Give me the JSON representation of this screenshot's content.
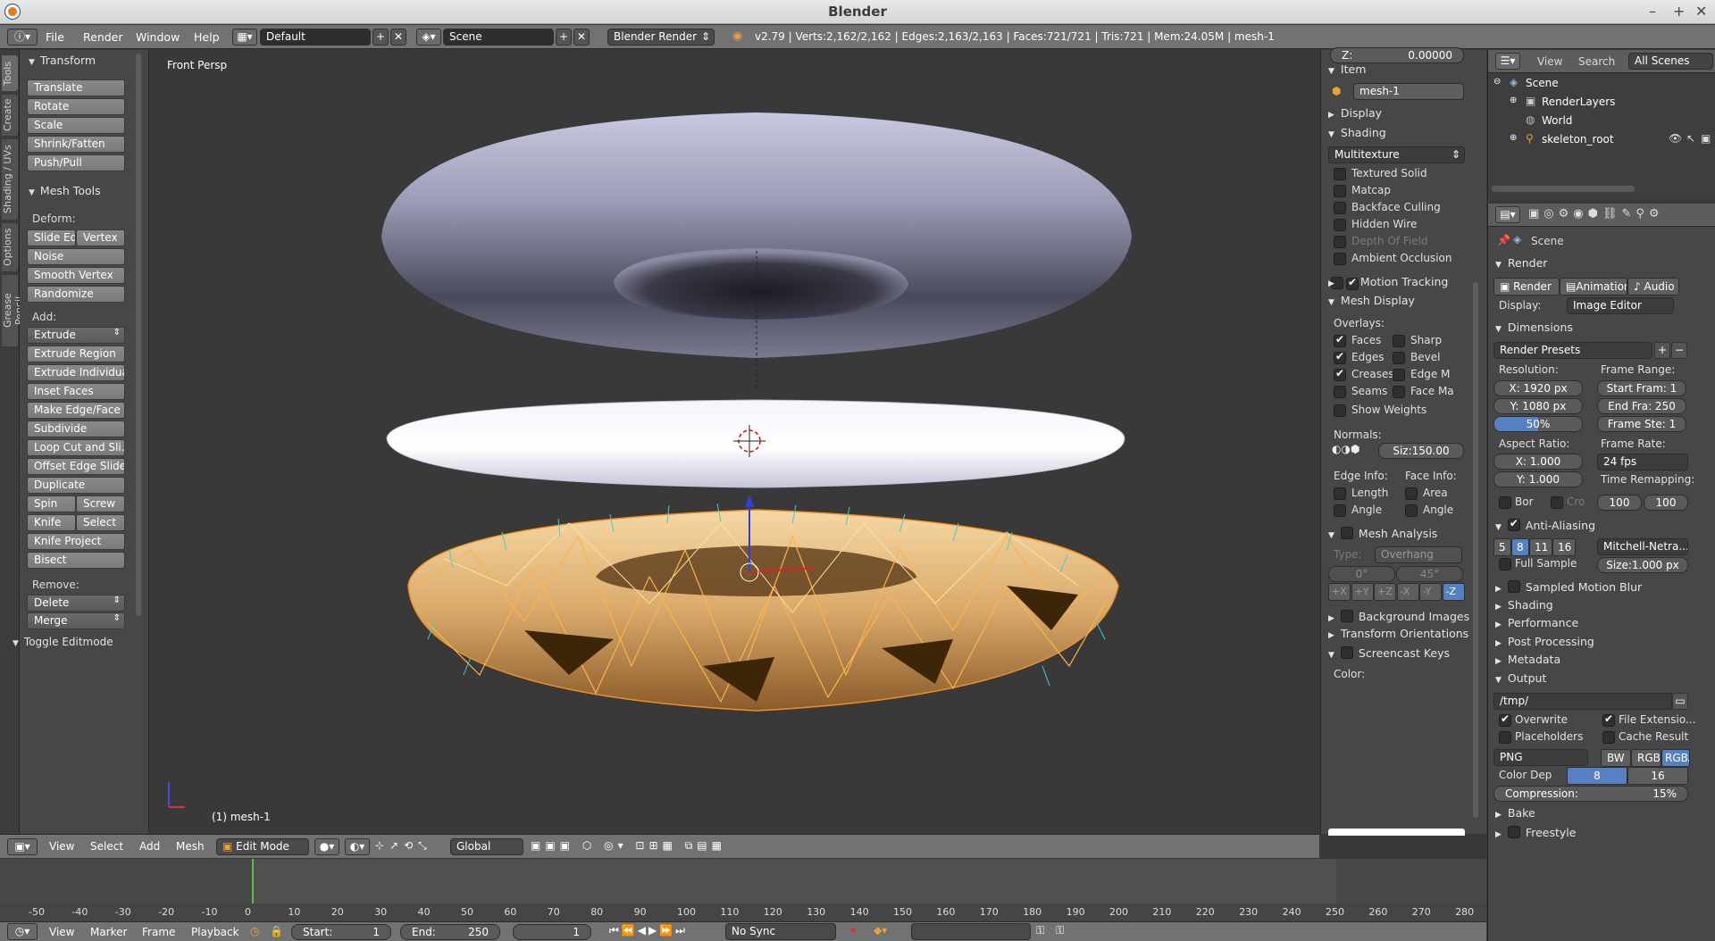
{
  "window": {
    "title": "Blender"
  },
  "menubar": {
    "items": [
      "File",
      "Render",
      "Window",
      "Help"
    ],
    "layout": "Default",
    "scene": "Scene",
    "engine": "Blender Render",
    "stats": "v2.79 | Verts:2,162/2,162 | Edges:2,163/2,163 | Faces:721/721 | Tris:721 | Mem:24.05M | mesh-1"
  },
  "side_tabs": [
    "Tools",
    "Create",
    "Shading / UVs",
    "Options",
    "Grease Pencil"
  ],
  "toolshelf": {
    "transform_title": "Transform",
    "transform_buttons": [
      "Translate",
      "Rotate",
      "Scale",
      "Shrink/Fatten",
      "Push/Pull"
    ],
    "mesh_tools_title": "Mesh Tools",
    "deform_label": "Deform:",
    "slide_edge": "Slide Ed",
    "vertex": "Vertex",
    "deform_buttons": [
      "Noise",
      "Smooth Vertex",
      "Randomize"
    ],
    "add_label": "Add:",
    "extrude": "Extrude",
    "add_buttons": [
      "Extrude Region",
      "Extrude Individual",
      "Inset Faces",
      "Make Edge/Face",
      "Subdivide",
      "Loop Cut and Sli...",
      "Offset Edge Slide",
      "Duplicate"
    ],
    "spin": "Spin",
    "screw": "Screw",
    "knife": "Knife",
    "select": "Select",
    "knife_project": "Knife Project",
    "bisect": "Bisect",
    "remove_label": "Remove:",
    "delete": "Delete",
    "merge": "Merge",
    "toggle_editmode": "Toggle Editmode"
  },
  "viewport": {
    "label": "Front Persp",
    "object_label": "(1) mesh-1"
  },
  "npanel": {
    "z_label": "Z:",
    "z_value": "0.00000",
    "item_title": "Item",
    "item_name": "mesh-1",
    "display_title": "Display",
    "shading_title": "Shading",
    "shading_mode": "Multitexture",
    "shading_checks": [
      {
        "label": "Textured Solid",
        "checked": false,
        "dim": false
      },
      {
        "label": "Matcap",
        "checked": false,
        "dim": false
      },
      {
        "label": "Backface Culling",
        "checked": false,
        "dim": false
      },
      {
        "label": "Hidden Wire",
        "checked": false,
        "dim": false
      },
      {
        "label": "Depth Of Field",
        "checked": false,
        "dim": true
      },
      {
        "label": "Ambient Occlusion",
        "checked": false,
        "dim": false
      }
    ],
    "motion_tracking": "Motion Tracking",
    "mesh_display_title": "Mesh Display",
    "overlays_label": "Overlays:",
    "overlays_left": [
      {
        "label": "Faces",
        "checked": true
      },
      {
        "label": "Edges",
        "checked": true
      },
      {
        "label": "Creases",
        "checked": true
      },
      {
        "label": "Seams",
        "checked": false
      }
    ],
    "overlays_right": [
      {
        "label": "Sharp",
        "checked": false
      },
      {
        "label": "Bevel",
        "checked": false
      },
      {
        "label": "Edge M",
        "checked": false
      },
      {
        "label": "Face Ma",
        "checked": false
      }
    ],
    "show_weights": "Show Weights",
    "normals_label": "Normals:",
    "normals_size": "Siz:150.00",
    "edge_info_label": "Edge Info:",
    "face_info_label": "Face Info:",
    "edge_info": [
      "Length",
      "Angle"
    ],
    "face_info": [
      "Area",
      "Angle"
    ],
    "mesh_analysis": "Mesh Analysis",
    "type_label": "Type:",
    "type_value": "Overhang",
    "angle_min": "0°",
    "angle_max": "45°",
    "axes": [
      "+X",
      "+Y",
      "+Z",
      "-X",
      "-Y",
      "-Z"
    ],
    "background_images": "Background Images",
    "transform_orientations": "Transform Orientations",
    "screencast_keys": "Screencast Keys",
    "color_label": "Color:"
  },
  "outliner": {
    "view": "View",
    "search": "Search",
    "all_scenes": "All Scenes",
    "rows": [
      "Scene",
      "RenderLayers",
      "World",
      "skeleton_root"
    ]
  },
  "properties": {
    "scene": "Scene",
    "render_title": "Render",
    "render_btn": "Render",
    "animation_btn": "Animation",
    "audio_btn": "Audio",
    "display_label": "Display:",
    "display_value": "Image Editor",
    "dimensions_title": "Dimensions",
    "render_presets": "Render Presets",
    "resolution_label": "Resolution:",
    "res_x": "X:    1920 px",
    "res_y": "Y:    1080 px",
    "res_pct": "50%",
    "frame_range_label": "Frame Range:",
    "start_frame": "Start Fram: 1",
    "end_frame": "End Fra: 250",
    "frame_step": "Frame Ste: 1",
    "aspect_label": "Aspect Ratio:",
    "aspect_x": "X:    1.000",
    "aspect_y": "Y:    1.000",
    "frame_rate_label": "Frame Rate:",
    "frame_rate": "24 fps",
    "time_remap_label": "Time Remapping:",
    "remap_old": "100",
    "remap_new": "100",
    "bor": "Bor",
    "cro": "Cro",
    "anti_aliasing": "Anti-Aliasing",
    "aa_samples": [
      "5",
      "8",
      "11",
      "16"
    ],
    "aa_filter": "Mitchell-Netra...",
    "full_sample": "Full Sample",
    "aa_size": "Size:1.000 px",
    "sampled_motion_blur": "Sampled Motion Blur",
    "sections_collapsed": [
      "Shading",
      "Performance",
      "Post Processing",
      "Metadata"
    ],
    "output_title": "Output",
    "output_path": "/tmp/",
    "overwrite": "Overwrite",
    "file_extensions": "File Extensio...",
    "placeholders": "Placeholders",
    "cache_result": "Cache Result",
    "format": "PNG",
    "bw": "BW",
    "rgb": "RGB",
    "rgba": "RGBA",
    "color_depth_label": "Color Dep",
    "depth_8": "8",
    "depth_16": "16",
    "compression": "Compression:",
    "compression_value": "15%",
    "bake": "Bake",
    "freestyle": "Freestyle"
  },
  "viewport_header": {
    "items": [
      "View",
      "Select",
      "Add",
      "Mesh"
    ],
    "mode": "Edit Mode",
    "orientation": "Global"
  },
  "timeline": {
    "ticks": [
      "-50",
      "-40",
      "-30",
      "-20",
      "-10",
      "0",
      "10",
      "20",
      "30",
      "40",
      "50",
      "60",
      "70",
      "80",
      "90",
      "100",
      "110",
      "120",
      "130",
      "140",
      "150",
      "160",
      "170",
      "180",
      "190",
      "200",
      "210",
      "220",
      "230",
      "240",
      "250",
      "260",
      "270",
      "280"
    ],
    "current_frame_value": 0,
    "header_items": [
      "View",
      "Marker",
      "Frame",
      "Playback"
    ],
    "start": "Start:",
    "start_val": "1",
    "end": "End:",
    "end_val": "250",
    "current": "1",
    "sync": "No Sync"
  }
}
